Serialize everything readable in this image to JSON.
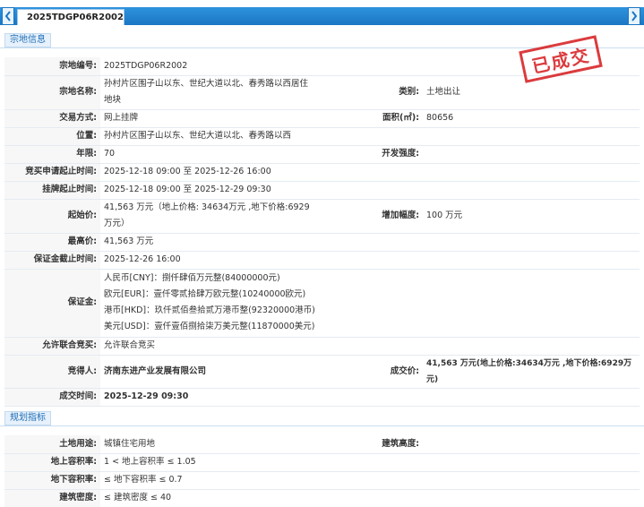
{
  "tabbar": {
    "tab_label": "2025TDGP06R2002"
  },
  "section1": {
    "title": "宗地信息"
  },
  "section2": {
    "title": "规划指标"
  },
  "stamp": {
    "text": "已成交"
  },
  "land": {
    "code_label": "宗地编号:",
    "code": "2025TDGP06R2002",
    "name_label": "宗地名称:",
    "name": "孙村片区围子山以东、世纪大道以北、春秀路以西居住地块",
    "category_label": "类别:",
    "category": "土地出让",
    "trade_label": "交易方式:",
    "trade": "网上挂牌",
    "area_label": "面积(㎡):",
    "area": "80656",
    "location_label": "位置:",
    "location": "孙村片区围子山以东、世纪大道以北、春秀路以西",
    "term_label": "年限:",
    "term": "70",
    "dev_label": "开发强度:",
    "dev": "",
    "apply_time_label": "竞买申请起止时间:",
    "apply_time": "2025-12-18 09:00 至 2025-12-26 16:00",
    "listing_time_label": "挂牌起止时间:",
    "listing_time": "2025-12-18 09:00 至 2025-12-29 09:30",
    "start_price_label": "起始价:",
    "start_price": "41,563 万元（地上价格: 34634万元 ,地下价格:6929万元）",
    "increment_label": "增加幅度:",
    "increment": "100 万元",
    "max_price_label": "最高价:",
    "max_price": "41,563 万元",
    "deposit_deadline_label": "保证金截止时间:",
    "deposit_deadline": "2025-12-26 16:00",
    "deposit_label": "保证金:",
    "deposit_lines": [
      "人民币[CNY]：捌仟肆佰万元整(84000000元)",
      "欧元[EUR]：壹仟零贰拾肆万欧元整(10240000欧元)",
      "港币[HKD]：玖仟贰佰叁拾贰万港币整(92320000港币)",
      "美元[USD]：壹仟壹佰捌拾柒万美元整(11870000美元)"
    ],
    "joint_label": "允许联合竞买:",
    "joint": "允许联合竞买",
    "bidder_label": "竞得人:",
    "bidder": "济南东进产业发展有限公司",
    "deal_price_label": "成交价:",
    "deal_price": "41,563 万元(地上价格:34634万元 ,地下价格:6929万元)",
    "deal_time_label": "成交时间:",
    "deal_time": "2025-12-29 09:30"
  },
  "planning": {
    "use_label": "土地用途:",
    "use": "城镇住宅用地",
    "height_label": "建筑高度:",
    "height": "",
    "far_above_label": "地上容积率:",
    "far_above": "1 < 地上容积率 ≤ 1.05",
    "far_below_label": "地下容积率:",
    "far_below": "≤ 地下容积率 ≤ 0.7",
    "density_label": "建筑密度:",
    "density": "≤ 建筑密度 ≤ 40"
  },
  "colors": {
    "header_blue": "#1a76c4",
    "accent_blue": "#1a8be0",
    "stamp_red": "#d8262a"
  },
  "icons": {
    "prev": "chevron-left-icon",
    "next": "chevron-right-icon"
  }
}
